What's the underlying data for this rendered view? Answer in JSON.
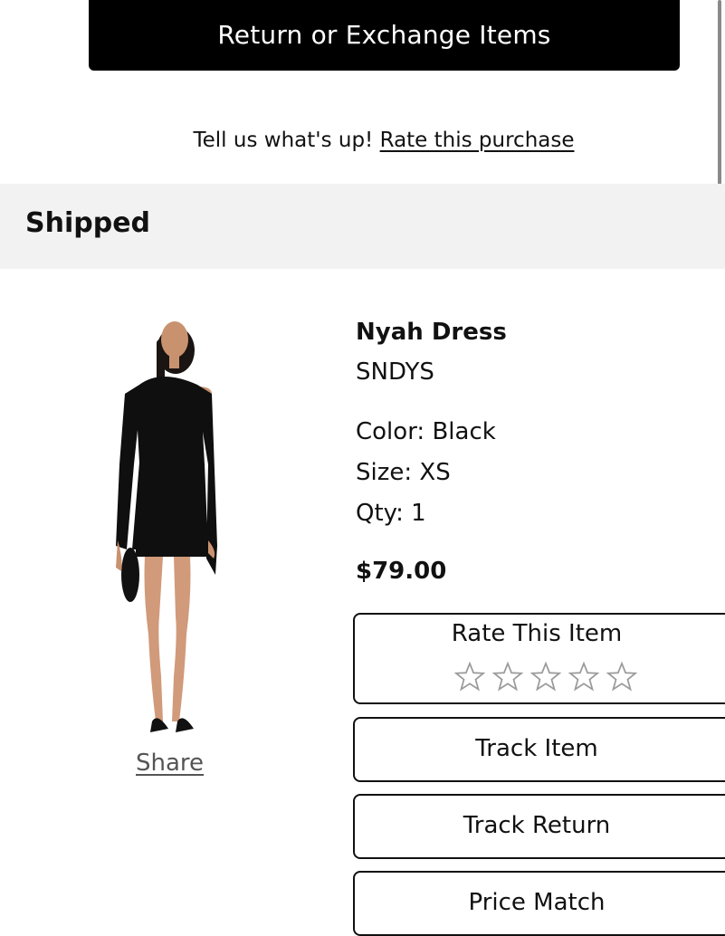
{
  "order_actions": {
    "return_exchange_label": "Return or Exchange Items"
  },
  "rate_prompt": {
    "text": "Tell us what's up!",
    "link_label": "Rate this purchase"
  },
  "section": {
    "title": "Shipped"
  },
  "product": {
    "name": "Nyah Dress",
    "brand": "SNDYS",
    "color_label": "Color: Black",
    "size_label": "Size: XS",
    "qty_label": "Qty: 1",
    "price": "$79.00",
    "share_label": "Share",
    "image_icon": "product-photo-black-mini-dress"
  },
  "item_actions": {
    "rate_item_label": "Rate This Item",
    "rating_stars_total": 5,
    "rating_stars_filled": 0,
    "track_item_label": "Track Item",
    "track_return_label": "Track Return",
    "price_match_label": "Price Match"
  },
  "colors": {
    "primary_button_bg": "#000000",
    "section_header_bg": "#f2f2f2",
    "text": "#111111"
  }
}
